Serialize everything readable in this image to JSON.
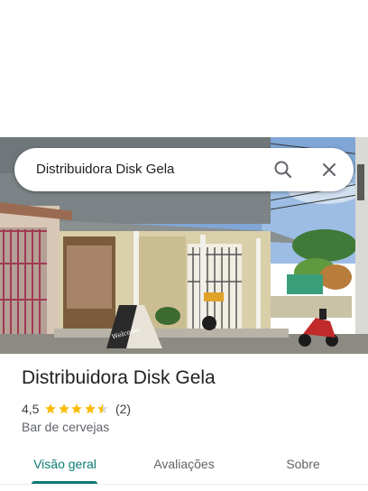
{
  "search": {
    "query": "Distribuidora Disk Gela"
  },
  "place": {
    "name": "Distribuidora Disk Gela",
    "rating": "4,5",
    "rating_value": 4.5,
    "review_count": "(2)",
    "category": "Bar de cervejas",
    "photo_sign_text": "Welcome"
  },
  "tabs": [
    {
      "label": "Visão geral",
      "active": true
    },
    {
      "label": "Avaliações",
      "active": false
    },
    {
      "label": "Sobre",
      "active": false
    }
  ],
  "colors": {
    "accent": "#0b7a75",
    "star": "#fbbc04",
    "text_primary": "#202124",
    "text_secondary": "#5f6368"
  },
  "icons": {
    "search": "search-icon",
    "close": "close-icon",
    "star": "star-icon"
  }
}
